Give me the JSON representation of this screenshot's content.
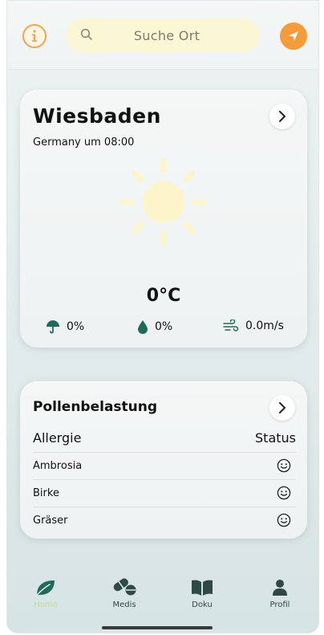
{
  "header": {
    "search_placeholder": "Suche Ort",
    "info_icon": "info-icon",
    "location_icon": "location-arrow-icon",
    "colors": {
      "info": "#f3a64a",
      "search_bg": "#fbf6d4",
      "location": "#f39c39"
    }
  },
  "weather": {
    "city": "Wiesbaden",
    "subtitle": "Germany um 08:00",
    "condition_icon": "sun-icon",
    "temperature": "0°C",
    "precipitation": "0%",
    "humidity": "0%",
    "wind": "0.0m/s",
    "icon_color": "#1d6b5a"
  },
  "pollen": {
    "title": "Pollenbelastung",
    "col_allergy": "Allergie",
    "col_status": "Status",
    "items": [
      {
        "name": "Ambrosia",
        "status_icon": "smiley-icon"
      },
      {
        "name": "Birke",
        "status_icon": "smiley-icon"
      },
      {
        "name": "Gräser",
        "status_icon": "smiley-icon"
      }
    ]
  },
  "nav": {
    "items": [
      {
        "label": "Home",
        "icon": "leaf-icon",
        "active": true
      },
      {
        "label": "Medis",
        "icon": "pills-icon",
        "active": false
      },
      {
        "label": "Doku",
        "icon": "book-icon",
        "active": false
      },
      {
        "label": "Profil",
        "icon": "person-icon",
        "active": false
      }
    ],
    "active_color": "#c4dc8e",
    "icon_color": "#2f4a44"
  }
}
